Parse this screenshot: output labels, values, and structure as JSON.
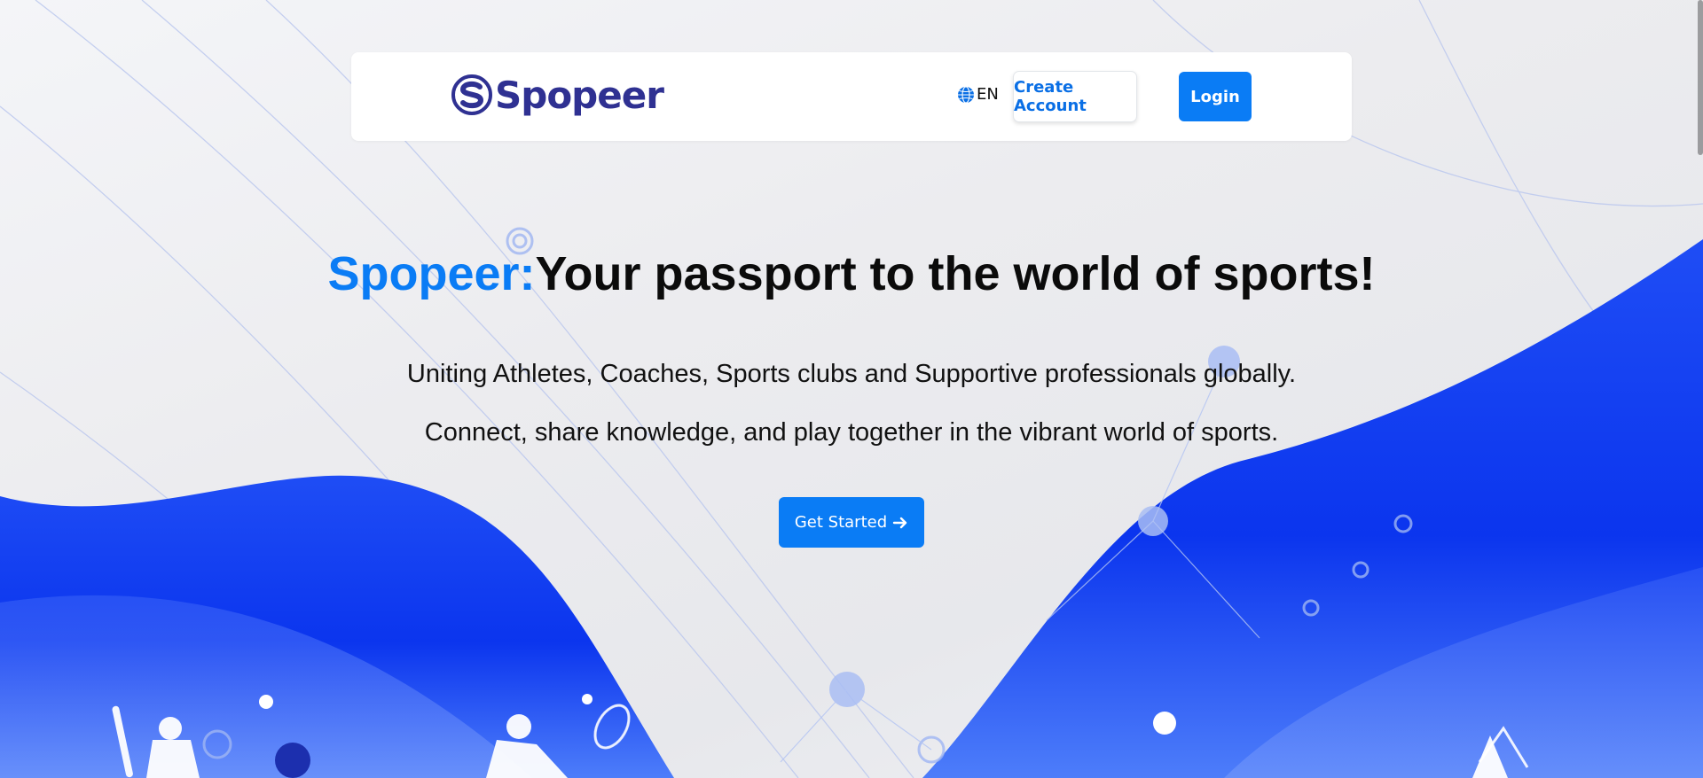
{
  "brand": {
    "name": "Spopeer",
    "logo_icon": "spopeer-s-logo-icon",
    "color": "#2f3192"
  },
  "nav": {
    "language": "EN",
    "language_icon": "globe-icon",
    "create_account_label": "Create Account",
    "login_label": "Login"
  },
  "hero": {
    "title_brand": "Spopeer:",
    "title_rest": "Your passport to the world of sports!",
    "subtitle_1": "Uniting Athletes, Coaches, Sports clubs and Supportive professionals globally.",
    "subtitle_2": "Connect, share knowledge, and play together in the vibrant world of sports.",
    "cta_label": "Get Started",
    "cta_icon": "arrow-right-icon"
  },
  "colors": {
    "accent": "#0a7cf5",
    "wave_blue": "#0d3cf0",
    "text": "#0b0b0b"
  }
}
